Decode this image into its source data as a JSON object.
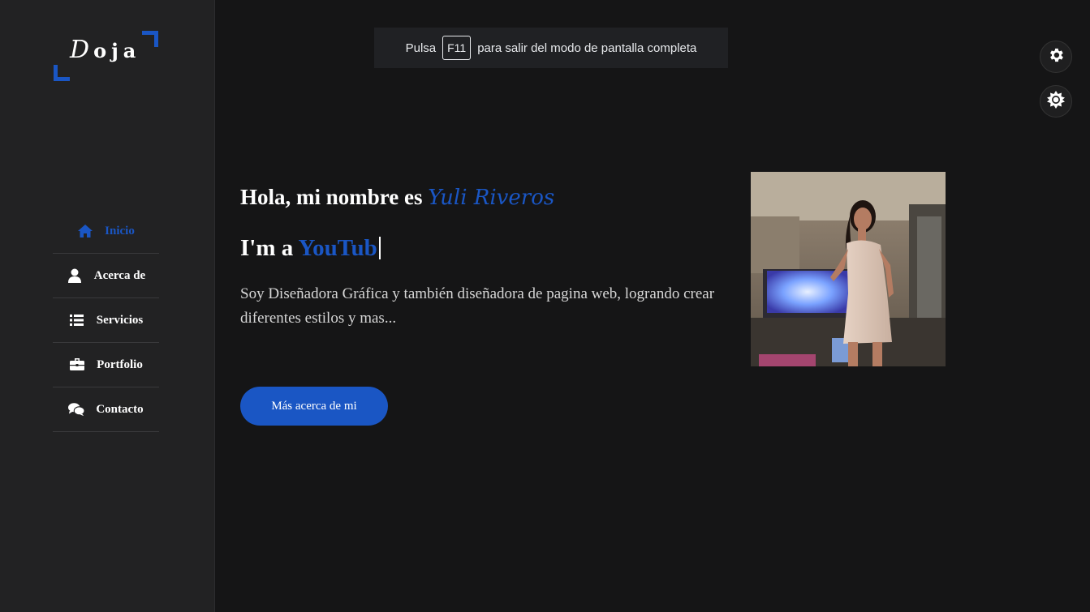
{
  "sidebar": {
    "logo": {
      "initial": "D",
      "rest": "oja"
    },
    "items": [
      {
        "label": "Inicio",
        "icon": "home-icon",
        "active": true
      },
      {
        "label": "Acerca de",
        "icon": "user-icon",
        "active": false
      },
      {
        "label": "Servicios",
        "icon": "list-icon",
        "active": false
      },
      {
        "label": "Portfolio",
        "icon": "briefcase-icon",
        "active": false
      },
      {
        "label": "Contacto",
        "icon": "comments-icon",
        "active": false
      }
    ]
  },
  "fullscreen_notice": {
    "prefix": "Pulsa",
    "key": "F11",
    "suffix": "para salir del modo de pantalla completa"
  },
  "hero": {
    "greeting": "Hola, mi nombre es",
    "name": "Yuli Riveros",
    "role_prefix": "I'm a",
    "role": "YouTub",
    "description": "Soy Diseñadora Gráfica y también diseñadora de pagina web, logrando crear diferentes estilos y mas...",
    "cta_label": "Más acerca de mi"
  },
  "colors": {
    "accent": "#1a56c4",
    "background": "#151516",
    "sidebar": "#222223"
  },
  "right_controls": {
    "settings_icon": "gear-icon",
    "theme_icon": "sun-icon"
  }
}
